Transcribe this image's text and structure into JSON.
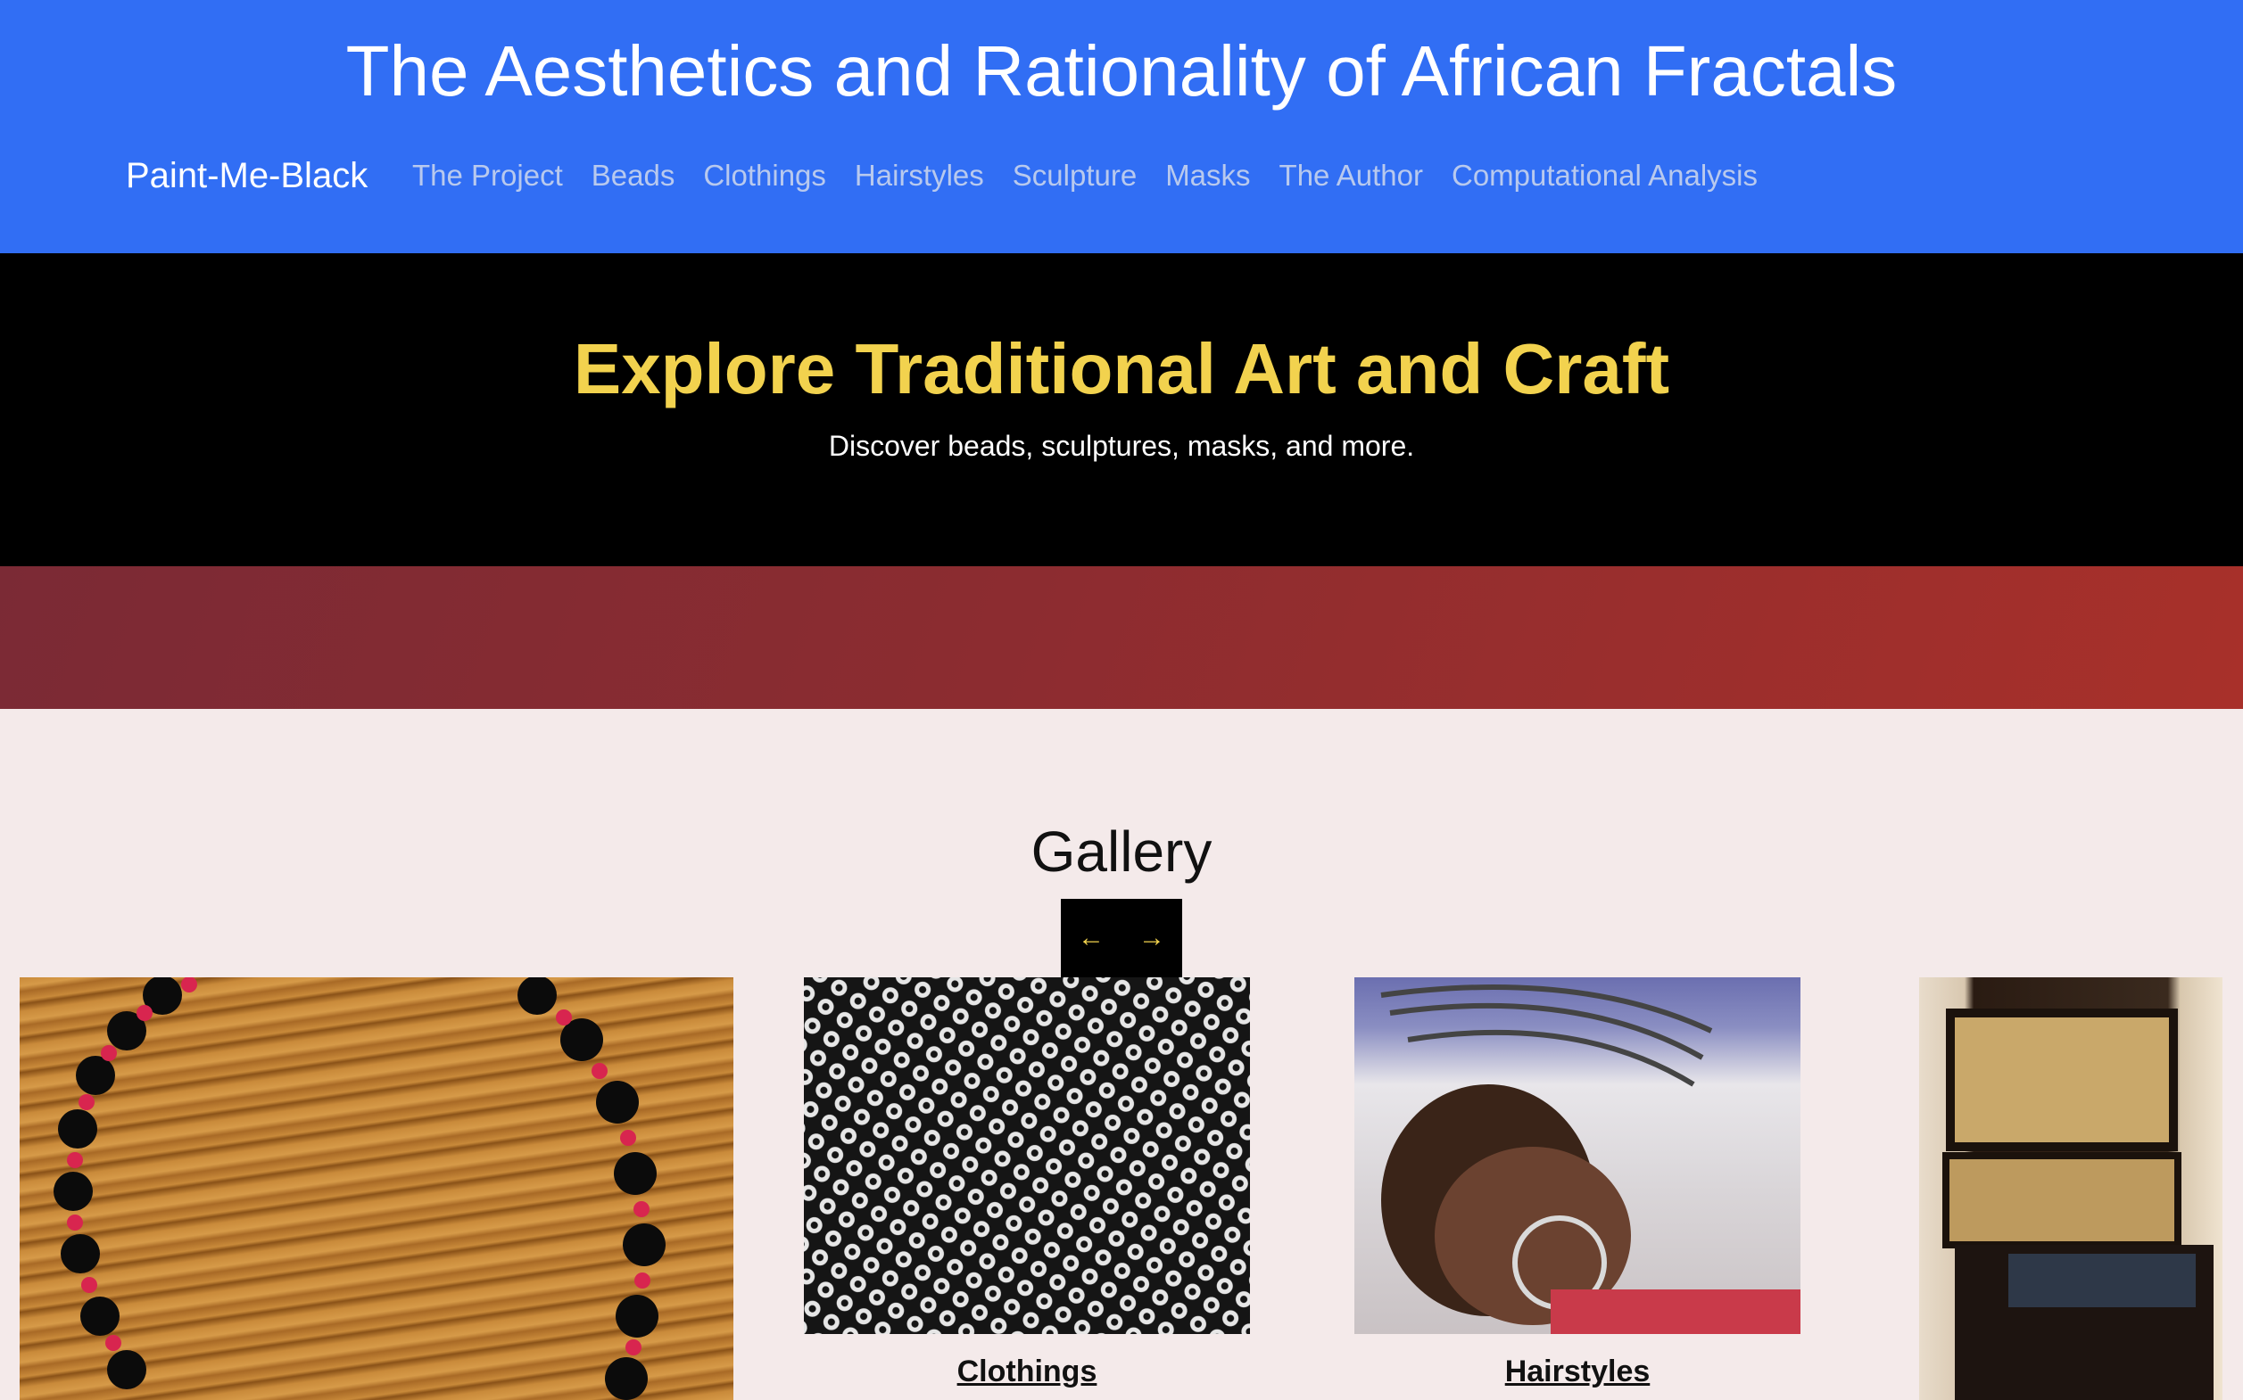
{
  "header": {
    "title": "The Aesthetics and Rationality of African Fractals",
    "brand": "Paint-Me-Black",
    "nav": [
      "The Project",
      "Beads",
      "Clothings",
      "Hairstyles",
      "Sculpture",
      "Masks",
      "The Author",
      "Computational Analysis"
    ]
  },
  "hero": {
    "title": "Explore Traditional Art and Craft",
    "subtitle": "Discover beads, sculptures, masks, and more."
  },
  "gallery": {
    "title": "Gallery",
    "prev_icon": "arrow-left-icon",
    "next_icon": "arrow-right-icon",
    "prev_glyph": "←",
    "next_glyph": "→",
    "items": [
      {
        "caption": ""
      },
      {
        "caption": "Clothings"
      },
      {
        "caption": "Hairstyles"
      },
      {
        "caption": ""
      }
    ]
  },
  "colors": {
    "header_bg": "#316ef4",
    "hero_title": "#f2d24e",
    "band_start": "#7b2a35",
    "band_end": "#a8302a",
    "page_bg": "#f4eaea"
  }
}
